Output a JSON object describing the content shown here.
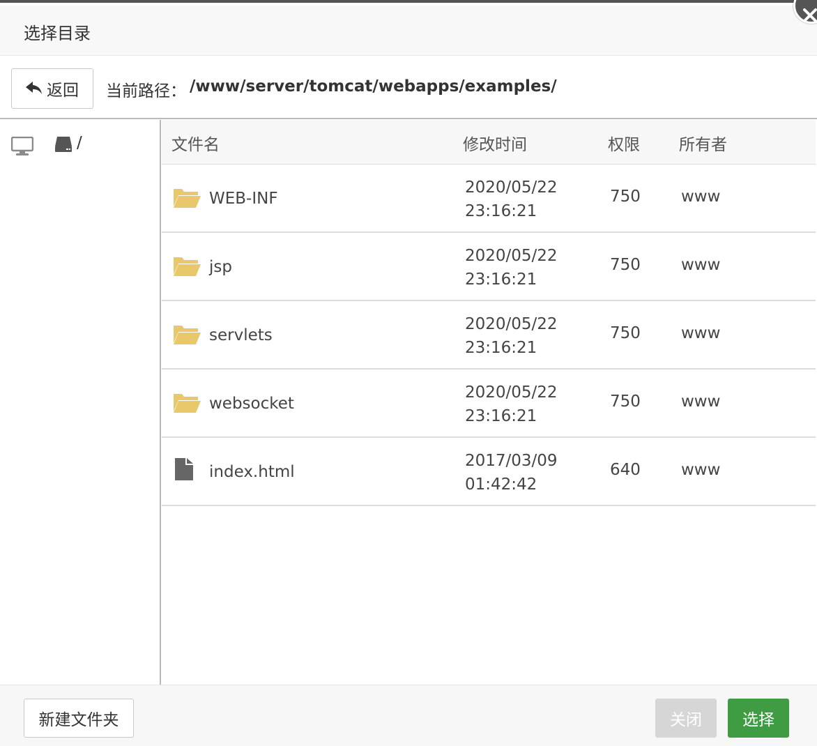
{
  "dialog": {
    "title": "选择目录"
  },
  "pathbar": {
    "back_label": "返回",
    "path_label": "当前路径：",
    "path_value": "/www/server/tomcat/webapps/examples/"
  },
  "sidebar": {
    "root_label": "/"
  },
  "table": {
    "headers": {
      "name": "文件名",
      "mtime": "修改时间",
      "perm": "权限",
      "owner": "所有者"
    },
    "rows": [
      {
        "type": "folder",
        "name": "WEB-INF",
        "date": "2020/05/22",
        "time": "23:16:21",
        "perm": "750",
        "owner": "www"
      },
      {
        "type": "folder",
        "name": "jsp",
        "date": "2020/05/22",
        "time": "23:16:21",
        "perm": "750",
        "owner": "www"
      },
      {
        "type": "folder",
        "name": "servlets",
        "date": "2020/05/22",
        "time": "23:16:21",
        "perm": "750",
        "owner": "www"
      },
      {
        "type": "folder",
        "name": "websocket",
        "date": "2020/05/22",
        "time": "23:16:21",
        "perm": "750",
        "owner": "www"
      },
      {
        "type": "file",
        "name": "index.html",
        "date": "2017/03/09",
        "time": "01:42:42",
        "perm": "640",
        "owner": "www"
      }
    ]
  },
  "footer": {
    "new_folder_label": "新建文件夹",
    "close_label": "关闭",
    "select_label": "选择"
  },
  "colors": {
    "folder": "#e8c86a",
    "file_icon": "#666666",
    "select_button": "#3f9c43",
    "close_button_disabled": "#d6d6d6"
  },
  "icons": {
    "back": "reply-arrow-icon",
    "computer": "monitor-icon",
    "disk": "hard-drive-icon",
    "folder": "folder-open-icon",
    "file": "file-icon",
    "dialog_close": "close-icon"
  }
}
